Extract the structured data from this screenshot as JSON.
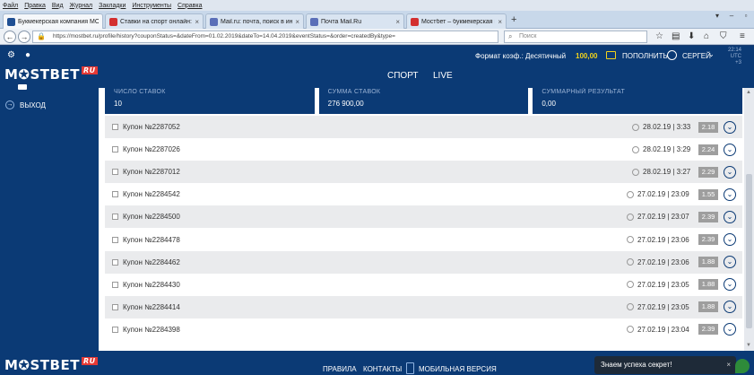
{
  "browser": {
    "menu": [
      "Файл",
      "Правка",
      "Вид",
      "Журнал",
      "Закладки",
      "Инструменты",
      "Справка"
    ],
    "tabs": [
      {
        "title": "Букмекерская компания МОСТБ...",
        "color": "#1f4f93",
        "active": true
      },
      {
        "title": "Ставки на спорт онлайн: ре...",
        "color": "#d32f2f",
        "active": false
      },
      {
        "title": "Mail.ru: почта, поиск в инте...",
        "color": "#5b6fb8",
        "active": false
      },
      {
        "title": "Почта Mail.Ru",
        "color": "#5b6fb8",
        "active": false
      },
      {
        "title": "Мостбет – букмекерская ко...",
        "color": "#d32f2f",
        "active": false
      }
    ],
    "new_tab": "+",
    "url": "https://mostbet.ru/profile/history?couponStatus=&dateFrom=01.02.2019&dateTo=14.04.2019&eventStatus=&order=createdBy&type=",
    "search_placeholder": "Поиск"
  },
  "header": {
    "odds_format": "Формат коэф.: Десятичный",
    "balance": "100,00",
    "deposit": "ПОПОЛНИТЬ",
    "username": "СЕРГЕЙ",
    "time": "22:14",
    "timezone": "UTC +3",
    "nav": [
      "СПОРТ",
      "LIVE"
    ],
    "logo_text": "M✪STBET",
    "logo_suffix": "RU"
  },
  "sidebar": {
    "exit": "ВЫХОД"
  },
  "summary": [
    {
      "label": "ЧИСЛО СТАВОК",
      "value": "10"
    },
    {
      "label": "СУММА СТАВОК",
      "value": "276 900,00"
    },
    {
      "label": "СУММАРНЫЙ РЕЗУЛЬТАТ",
      "value": "0,00"
    }
  ],
  "coupons": [
    {
      "name": "Купон №2287052",
      "datetime": "28.02.19 | 3:33",
      "coef": "2.18"
    },
    {
      "name": "Купон №2287026",
      "datetime": "28.02.19 | 3:29",
      "coef": "2.24"
    },
    {
      "name": "Купон №2287012",
      "datetime": "28.02.19 | 3:27",
      "coef": "2.29"
    },
    {
      "name": "Купон №2284542",
      "datetime": "27.02.19 | 23:09",
      "coef": "1.55"
    },
    {
      "name": "Купон №2284500",
      "datetime": "27.02.19 | 23:07",
      "coef": "2.39"
    },
    {
      "name": "Купон №2284478",
      "datetime": "27.02.19 | 23:06",
      "coef": "2.39"
    },
    {
      "name": "Купон №2284462",
      "datetime": "27.02.19 | 23:06",
      "coef": "1.88"
    },
    {
      "name": "Купон №2284430",
      "datetime": "27.02.19 | 23:05",
      "coef": "1.88"
    },
    {
      "name": "Купон №2284414",
      "datetime": "27.02.19 | 23:05",
      "coef": "1.88"
    },
    {
      "name": "Купон №2284398",
      "datetime": "27.02.19 | 23:04",
      "coef": "2.39"
    }
  ],
  "footer": {
    "rules": "ПРАВИЛА",
    "contacts": "КОНТАКТЫ",
    "mobile": "МОБИЛЬНАЯ ВЕРСИЯ",
    "chat": "Знаем успеха секрет!",
    "chat_close": "×"
  }
}
